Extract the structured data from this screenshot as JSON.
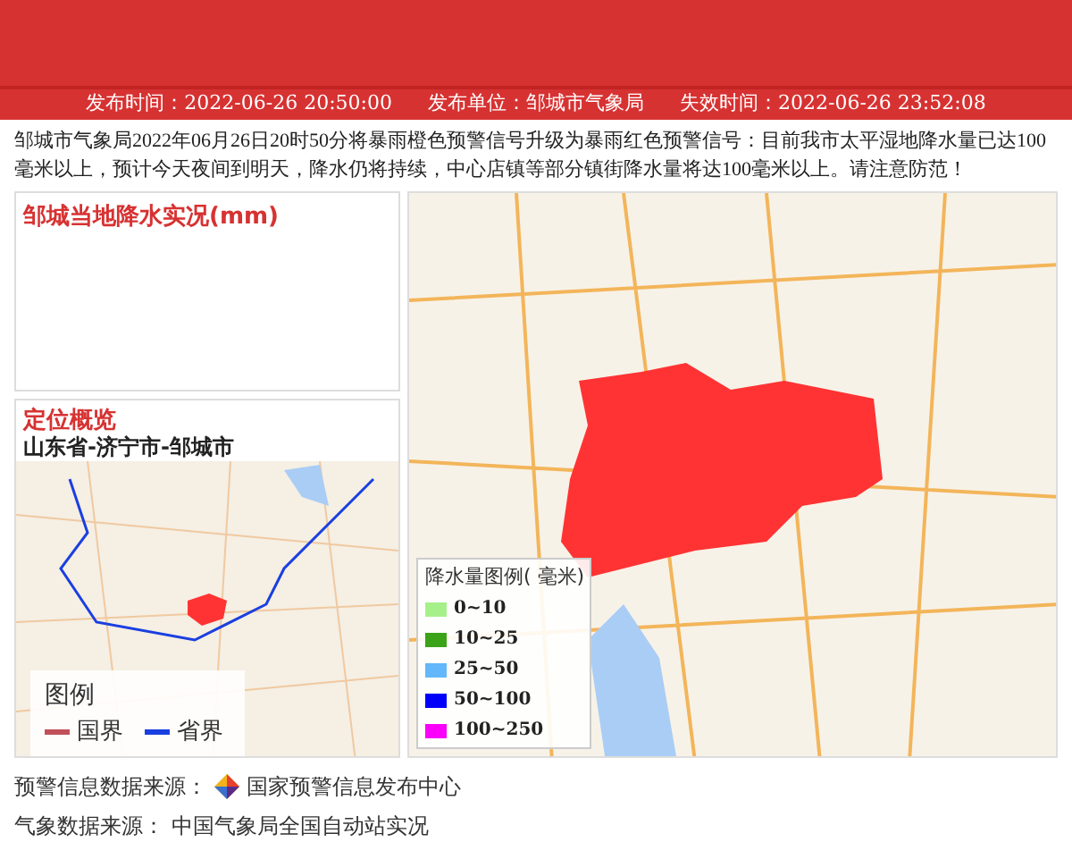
{
  "info_bar": [
    {
      "label": "发布时间：",
      "value": "2022-06-26 20:50:00"
    },
    {
      "label": "发布单位：",
      "value": "邹城市气象局"
    },
    {
      "label": "失效时间：",
      "value": "2022-06-26 23:52:08"
    }
  ],
  "message": "邹城市气象局2022年06月26日20时50分将暴雨橙色预警信号升级为暴雨红色预警信号：目前我市太平湿地降水量已达100毫米以上，预计今天夜间到明天，降水仍将持续，中心店镇等部分镇街降水量将达100毫米以上。请注意防范！",
  "rainfall_panel": {
    "title": "邹城当地降水实况(mm)"
  },
  "location_panel": {
    "title": "定位概览",
    "path": "山东省-济宁市-邹城市",
    "legend": {
      "title": "图例",
      "items": [
        {
          "label": "国界",
          "color": "#c0505a"
        },
        {
          "label": "省界",
          "color": "#1a3fe0"
        }
      ]
    }
  },
  "map_legend": {
    "title": "降水量图例( 毫米)",
    "items": [
      {
        "label": "0~10",
        "color": "#a6f08a"
      },
      {
        "label": "10~25",
        "color": "#3aa317"
      },
      {
        "label": "25~50",
        "color": "#62b8fa"
      },
      {
        "label": "50~100",
        "color": "#0000fa"
      },
      {
        "label": "100~250",
        "color": "#fa00fa"
      }
    ]
  },
  "footer": [
    {
      "label": "预警信息数据来源：",
      "source": "国家预警信息发布中心",
      "logo": true
    },
    {
      "label": "气象数据来源：",
      "source": "中国气象局全国自动站实况",
      "logo": false
    }
  ]
}
